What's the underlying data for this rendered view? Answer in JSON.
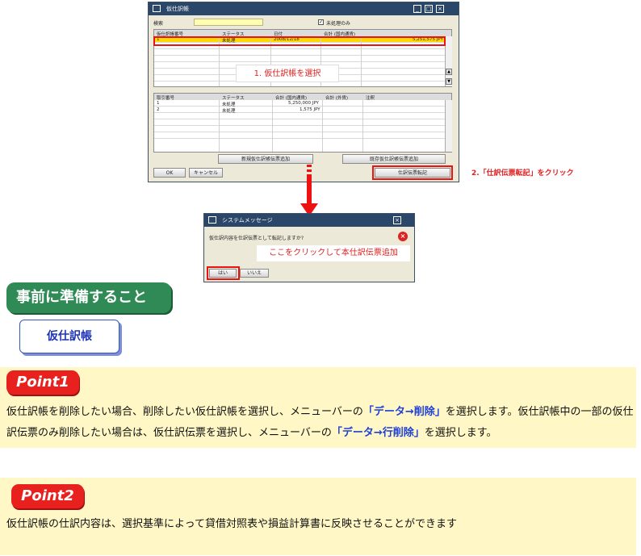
{
  "main_window": {
    "title": "仮仕訳帳",
    "search_label": "検索",
    "checkbox_label": "未処理のみ",
    "checkbox_checked": true,
    "upper_table": {
      "headers": [
        "仮仕訳帳番号",
        "ステータス",
        "日付",
        "合計 (国内通貨)"
      ],
      "rows": [
        {
          "no": "1",
          "status": "未処理",
          "date": "2008/12/18",
          "total": "5,251,575 JPY"
        }
      ]
    },
    "lower_table": {
      "headers": [
        "取引番号",
        "ステータス",
        "合計 (国内通貨)",
        "合計 (外貨)",
        "注釈"
      ],
      "rows": [
        {
          "no": "1",
          "status": "未処理",
          "total": "5,250,000 JPY"
        },
        {
          "no": "2",
          "status": "未処理",
          "total": "1,575 JPY"
        }
      ]
    },
    "btn_new": "新規仮仕訳帳伝票追加",
    "btn_existing": "既存仮仕訳帳伝票追加",
    "btn_ok": "OK",
    "btn_cancel": "キャンセル",
    "btn_post": "仕訳伝票転記"
  },
  "callouts": {
    "step1": "1. 仮仕訳帳を選択",
    "step2": "2.「仕訳伝票転記」をクリック",
    "step3": "ここをクリックして本仕訳伝票追加"
  },
  "dialog": {
    "title": "システムメッセージ",
    "message": "仮仕訳内容を仕訳伝票として転記しますか?",
    "yes": "はい",
    "no": "いいえ"
  },
  "section": {
    "heading": "事前に準備すること",
    "box": "仮仕訳帳"
  },
  "point1": {
    "label": "Point1",
    "t1": "仮仕訳帳を削除したい場合、削除したい仮仕訳帳を選択し、メニューバーの",
    "h1": "「データ→削除」",
    "t2": "を選択します。仮仕訳帳中の一部の仮仕",
    "t3": "訳伝票のみ削除したい場合は、仮仕訳伝票を選択し、メニューバーの",
    "h2": "「データ→行削除」",
    "t4": "を選択します。"
  },
  "point2": {
    "label": "Point2",
    "text": "仮仕訳帳の仕訳内容は、選択基準によって貸借対照表や損益計算書に反映させることができます"
  },
  "colors": {
    "title_bar": "#2a4668",
    "selection_highlight": "#ffd800",
    "callout_red": "#e02020",
    "section_green": "#2f8a55",
    "point_red": "#e8201e",
    "band_yellow": "#fff7c6",
    "highlight_blue": "#1d3fd8"
  }
}
